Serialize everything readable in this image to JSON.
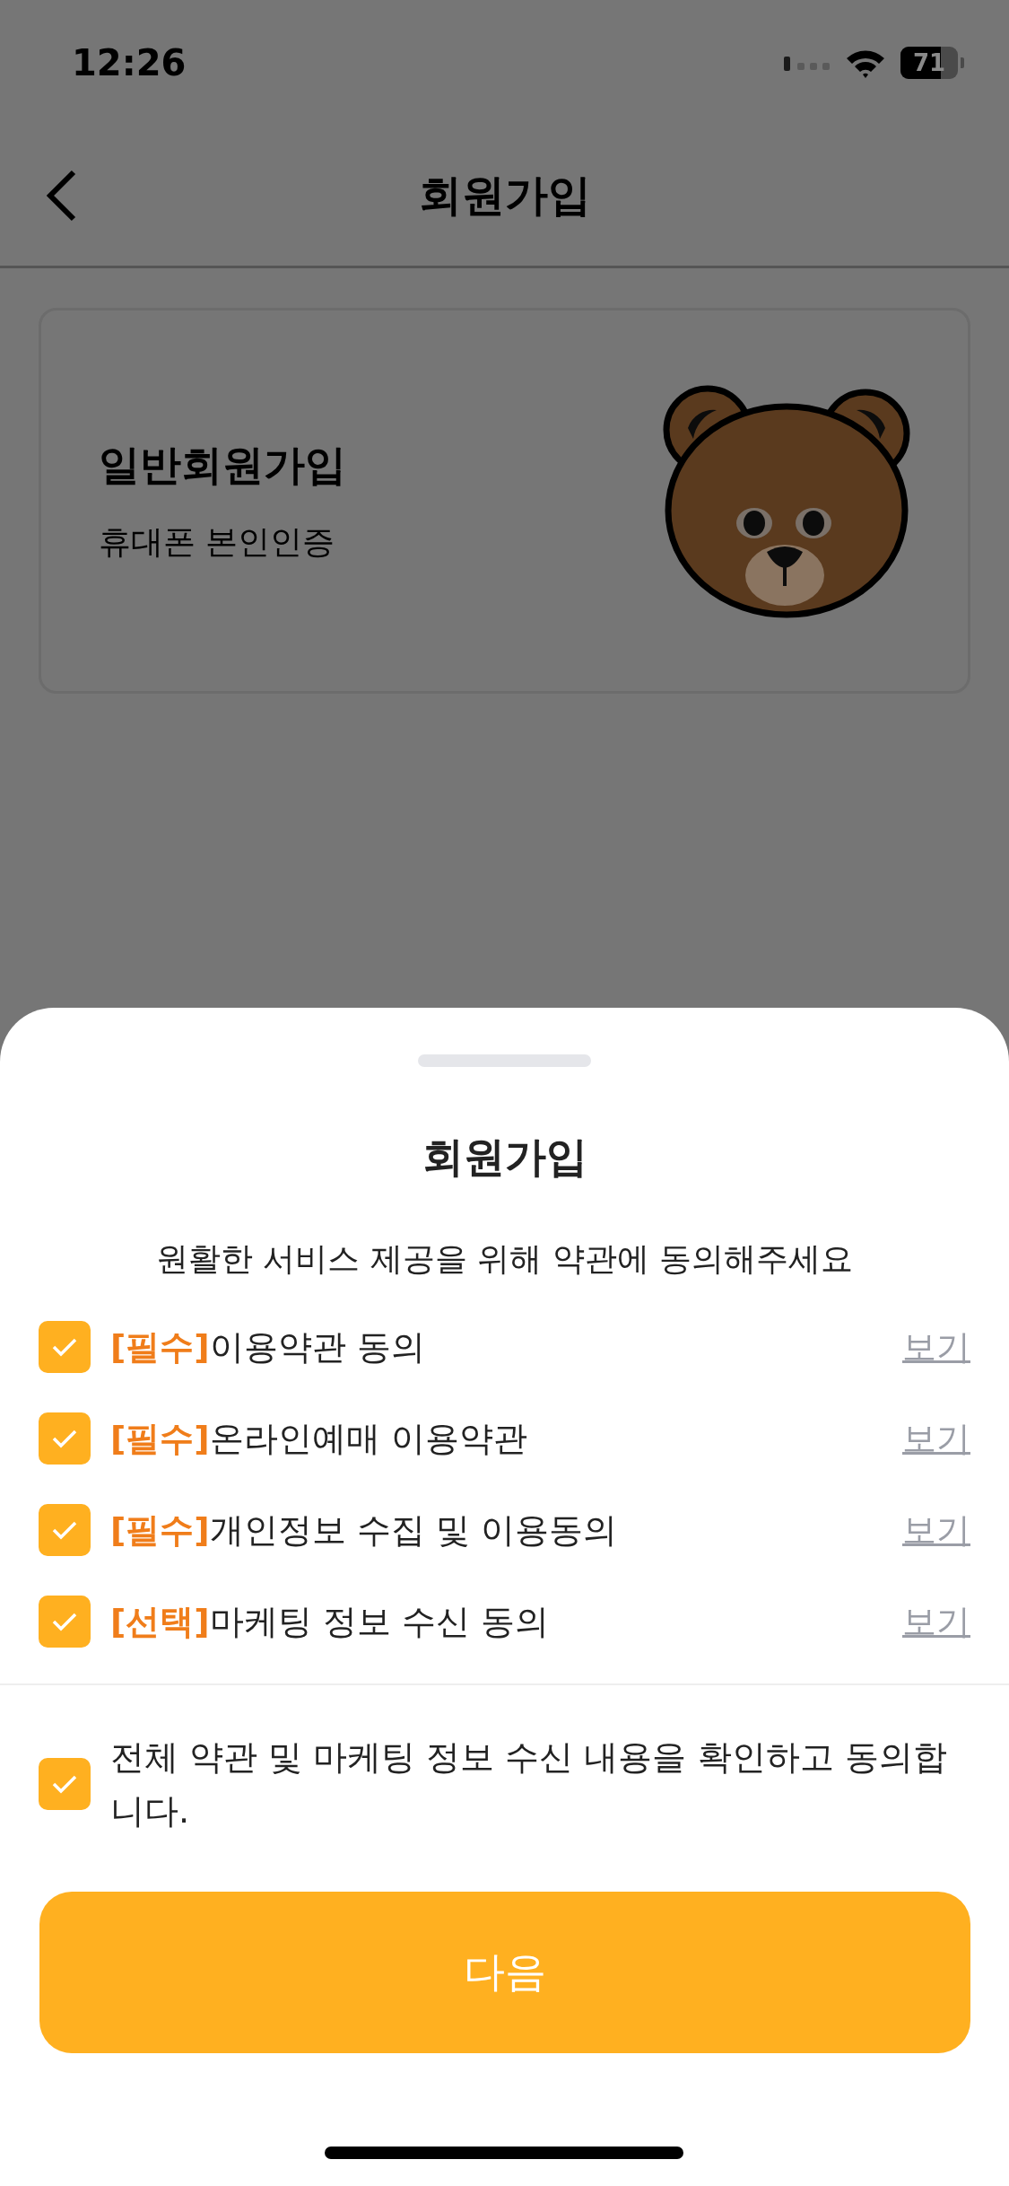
{
  "status_bar": {
    "time": "12:26",
    "battery": "71"
  },
  "nav": {
    "title": "회원가입"
  },
  "card": {
    "title": "일반회원가입",
    "subtitle": "휴대폰 본인인증",
    "kind": "picture"
  },
  "sheet": {
    "title": "회원가입",
    "subtitle": "원활한 서비스 제공을 위해 약관에 동의해주세요",
    "terms": [
      {
        "tag": "[필수]",
        "label": "이용약관 동의",
        "checked": true,
        "link": "보기"
      },
      {
        "tag": "[필수]",
        "label": "온라인예매 이용약관",
        "checked": true,
        "link": "보기"
      },
      {
        "tag": "[필수]",
        "label": "개인정보 수집 및 이용동의",
        "checked": true,
        "link": "보기"
      },
      {
        "tag": "[선택]",
        "label": "마케팅 정보 수신 동의",
        "checked": true,
        "link": "보기"
      }
    ],
    "agree_all": {
      "label": "전체 약관 및 마케팅 정보 수신 내용을 확인하고 동의합니다.",
      "checked": true
    },
    "next_button": "다음"
  }
}
